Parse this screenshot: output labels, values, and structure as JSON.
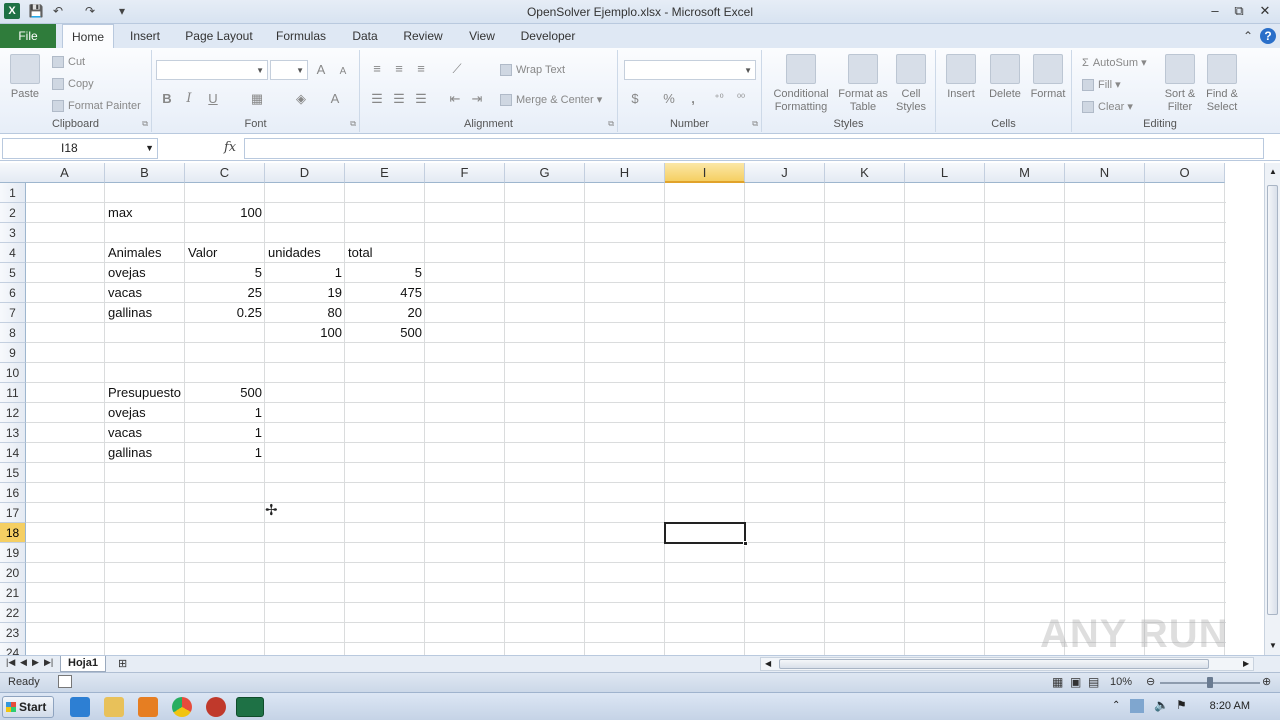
{
  "window": {
    "title": "OpenSolver Ejemplo.xlsx - Microsoft Excel",
    "app_icon": "X",
    "controls": [
      "–",
      "⧉",
      "✕"
    ]
  },
  "tabs": [
    {
      "label": "File"
    },
    {
      "label": "Home"
    },
    {
      "label": "Insert"
    },
    {
      "label": "Page Layout"
    },
    {
      "label": "Formulas"
    },
    {
      "label": "Data"
    },
    {
      "label": "Review"
    },
    {
      "label": "View"
    },
    {
      "label": "Developer"
    }
  ],
  "ribbon": {
    "clipboard": {
      "label": "Clipboard",
      "paste": "Paste",
      "cut": "Cut",
      "copy": "Copy",
      "format_painter": "Format Painter"
    },
    "font": {
      "label": "Font",
      "bold": "B",
      "italic": "I",
      "underline": "U",
      "grow": "A",
      "shrink": "A"
    },
    "alignment": {
      "label": "Alignment",
      "wrap_text": "Wrap Text",
      "merge_center": "Merge & Center"
    },
    "number": {
      "label": "Number",
      "currency": "$",
      "percent": "%",
      "comma": ","
    },
    "styles": {
      "label": "Styles",
      "conditional_formatting": "Conditional Formatting",
      "format_as_table": "Format as Table",
      "cell_styles": "Cell Styles"
    },
    "cells": {
      "label": "Cells",
      "insert": "Insert",
      "delete": "Delete",
      "format": "Format"
    },
    "editing": {
      "label": "Editing",
      "autosum": "AutoSum",
      "fill": "Fill",
      "clear": "Clear",
      "sort_filter": "Sort & Filter",
      "find_select": "Find & Select"
    }
  },
  "formula_bar": {
    "name_box": "I18",
    "fx": "fx",
    "content": ""
  },
  "columns": [
    "A",
    "B",
    "C",
    "D",
    "E",
    "F",
    "G",
    "H",
    "I",
    "J",
    "K",
    "L",
    "M",
    "N",
    "O"
  ],
  "selected_column": "I",
  "rows": [
    "1",
    "2",
    "3",
    "4",
    "5",
    "6",
    "7",
    "8",
    "9",
    "10",
    "11",
    "12",
    "13",
    "14",
    "15",
    "16",
    "17",
    "18",
    "19",
    "20",
    "21",
    "22",
    "23",
    "24"
  ],
  "selected_row": "18",
  "cells": {
    "B2": "max",
    "C2": "100",
    "B4": "Animales",
    "C4": "Valor",
    "D4": "unidades",
    "E4": "total",
    "B5": "ovejas",
    "C5": "5",
    "D5": "1",
    "E5": "5",
    "B6": "vacas",
    "C6": "25",
    "D6": "19",
    "E6": "475",
    "B7": "gallinas",
    "C7": "0.25",
    "D7": "80",
    "E7": "20",
    "D8": "100",
    "E8": "500",
    "B11": "Presupuesto",
    "C11": "500",
    "B12": "ovejas",
    "C12": "1",
    "B13": "vacas",
    "C13": "1",
    "B14": "gallinas",
    "C14": "1"
  },
  "sheet_tabs": [
    {
      "label": "Hoja1"
    }
  ],
  "status": {
    "text": "Ready",
    "zoom": "10%"
  },
  "taskbar": {
    "start": "Start",
    "clock": "8:20 AM"
  },
  "watermark": "ANY RUN"
}
